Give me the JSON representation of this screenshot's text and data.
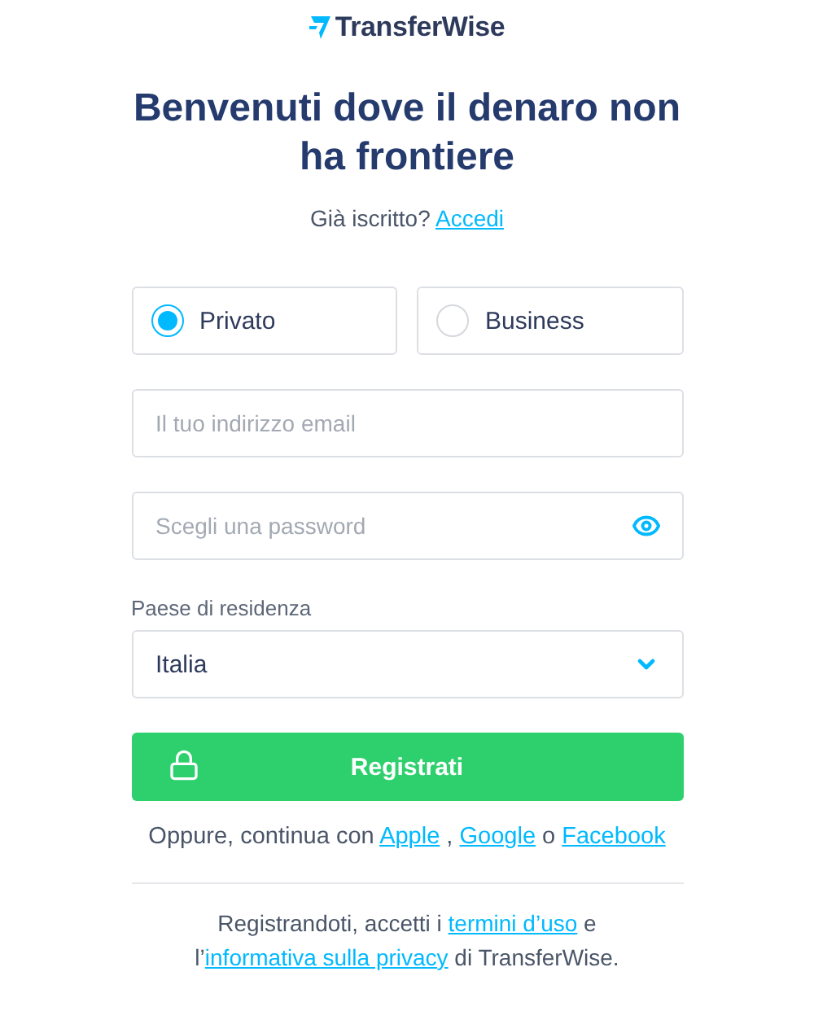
{
  "logo": {
    "text": "TransferWise"
  },
  "heading": "Benvenuti dove il denaro non ha frontiere",
  "login_prompt": {
    "text": "Già iscritto?",
    "link": "Accedi"
  },
  "account_types": [
    {
      "label": "Privato",
      "selected": true
    },
    {
      "label": "Business",
      "selected": false
    }
  ],
  "email": {
    "placeholder": "Il tuo indirizzo email"
  },
  "password": {
    "placeholder": "Scegli una password"
  },
  "country": {
    "label": "Paese di residenza",
    "value": "Italia"
  },
  "register_button": "Registrati",
  "social": [
    {
      "kind": "text",
      "text": "Oppure, continua con "
    },
    {
      "kind": "link",
      "text": "Apple"
    },
    {
      "kind": "text",
      "text": " , "
    },
    {
      "kind": "link",
      "text": "Google"
    },
    {
      "kind": "text",
      "text": " o "
    },
    {
      "kind": "link",
      "text": "Facebook"
    }
  ],
  "terms": [
    {
      "kind": "text",
      "text": "Registrandoti, accetti i "
    },
    {
      "kind": "link",
      "text": "termini d’uso"
    },
    {
      "kind": "text",
      "text": " e"
    },
    {
      "kind": "break"
    },
    {
      "kind": "text",
      "text": "l’"
    },
    {
      "kind": "link",
      "text": "informativa sulla privacy"
    },
    {
      "kind": "text",
      "text": " di TransferWise."
    }
  ]
}
